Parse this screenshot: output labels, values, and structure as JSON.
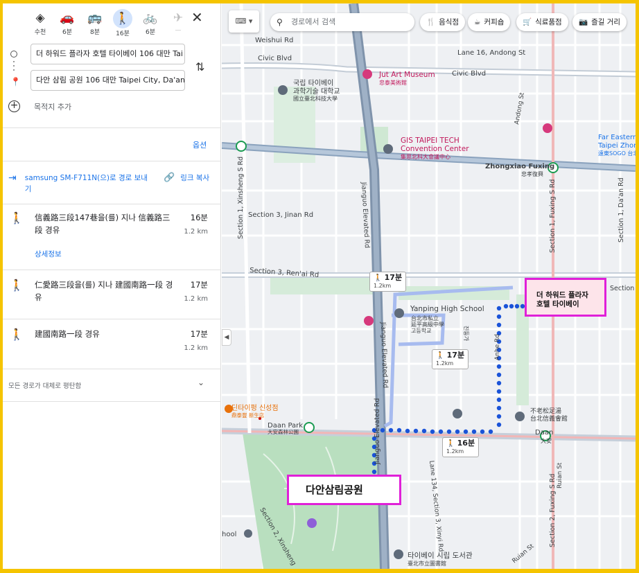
{
  "modes": [
    {
      "name": "best",
      "time": "수천"
    },
    {
      "name": "car",
      "time": "6분"
    },
    {
      "name": "transit",
      "time": "8분"
    },
    {
      "name": "walk",
      "time": "16분"
    },
    {
      "name": "bike",
      "time": "6분"
    },
    {
      "name": "flight",
      "time": "—"
    }
  ],
  "origin_value": "더 하워드 플라자 호텔 타이베이 106 대만 Tai",
  "destination_value": "다안 삼림 공원 106 대만 Taipei City, Da'an D",
  "add_destination": "목적지 추가",
  "options_label": "옵션",
  "send_to_phone": "samsung SM-F711N(으)로 경로 보내기",
  "copy_link": "링크 복사",
  "routes": [
    {
      "desc": "信義路三段147巷을(를) 지나 信義路三段 경유",
      "time": "16분",
      "dist": "1.2 km",
      "details": "상세정보"
    },
    {
      "desc": "仁愛路三段을(를) 지나 建國南路一段 경유",
      "time": "17분",
      "dist": "1.2 km"
    },
    {
      "desc": "建國南路一段 경유",
      "time": "17분",
      "dist": "1.2 km"
    }
  ],
  "flat_note": "모든 경로가 대체로 평탄함",
  "search_placeholder": "경로에서 검색",
  "chips": {
    "restaurant": "음식점",
    "coffee": "커피숍",
    "grocery": "식료품점",
    "things_to_do": "즐길 거리"
  },
  "callouts": {
    "hotel_line1": "더 하워드 플라자",
    "hotel_line2": "호텔 타이베이",
    "park": "다안삼림공원"
  },
  "route_tips": [
    {
      "time": "17분",
      "dist": "1.2km"
    },
    {
      "time": "17분",
      "dist": "1.2km"
    },
    {
      "time": "16분",
      "dist": "1.2km"
    }
  ],
  "map_labels": {
    "weishui": "Weishui Rd",
    "civic1": "Civic Blvd",
    "civic2": "Civic Blvd",
    "lane16": "Lane 16, Andong St",
    "jutart": "Jut Art Museum",
    "jutart_zh": "忠泰美術館",
    "ntut1": "국립 타이베이",
    "ntut2": "과학기술 대학교",
    "ntut_zh": "國立臺北科技大學",
    "gis1": "GIS TAIPEI TECH",
    "gis2": "Convention Center",
    "gis_zh": "集思北科大會議中心",
    "zhongxiao": "Zhongxiao Fuxing",
    "zhongxiao_zh": "忠孝復興",
    "fareast1": "Far Eastern",
    "fareast2": "Taipei Zhon",
    "fareast_zh": "遠東SOGO 台北",
    "jinan": "Section 3, Jinan Rd",
    "renai": "Section 3, Ren'ai Rd",
    "xinsheng": "Section 1, Xinsheng S Rd",
    "xinsheng2": "Section 2, Xinsheng",
    "jianguo": "Jianguo Elevated Rd",
    "jianguo2": "Jianguo Elevated Rd",
    "jianguo3": "Jianguo Elevated Rd",
    "yanping": "Yanping High School",
    "yanping_zh1": "台北市私立",
    "yanping_zh2": "延平高級中學",
    "yanping_zh3": "고등학교",
    "anhe": "Anhe Rd",
    "fuxing": "Section 1, Fuxing S Rd",
    "fuxing2": "Section 2, Fuxing S Rd",
    "daan_rd": "Section 1, Da'an Rd",
    "section": "Section",
    "jindong": "진둥가",
    "xinyi_lane": "Lane 134, Section 3, Xinyi Rd",
    "daanpark_st": "Daan Park",
    "daanpark_zh": "大安森林公園",
    "daan_st": "Daan",
    "daan_zh": "大安",
    "dintaifung": "딘타이펑 신성점",
    "dintaifung_zh": "鼎泰豐 新生店",
    "budong1": "不老松足湯",
    "budong2": "台北信義會館",
    "ruian": "Ruian St",
    "ruian2": "Ruian St",
    "library": "타이베이 시립 도서관",
    "library_zh": "臺北市立圖書館",
    "school_frag": "hool",
    "andong": "Andong St"
  }
}
